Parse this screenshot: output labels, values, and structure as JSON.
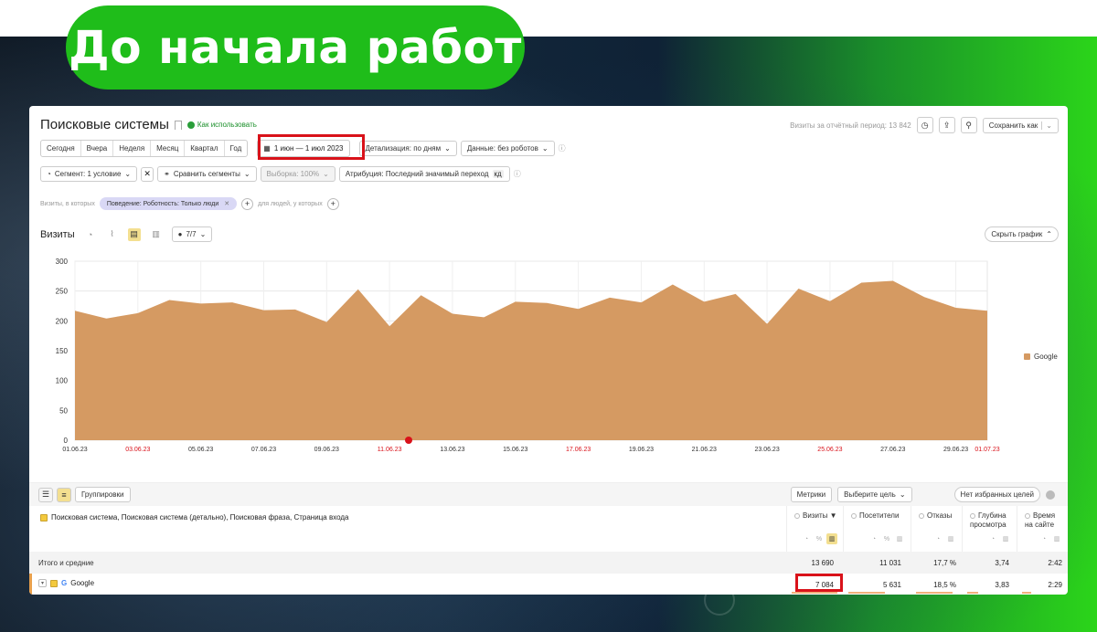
{
  "banner": {
    "title": "До начала работ"
  },
  "report": {
    "title": "Поисковые системы",
    "how_to_use": "Как использовать",
    "visits_summary": "Визиты за отчётный период: 13 842",
    "save_as": "Сохранить как"
  },
  "period_tabs": [
    "Сегодня",
    "Вчера",
    "Неделя",
    "Месяц",
    "Квартал",
    "Год"
  ],
  "date_range": "1 июн — 1 июл 2023",
  "detail": "Детализация: по дням",
  "data_filter": "Данные: без роботов",
  "segment": "Сегмент: 1 условие",
  "compare": "Сравнить сегменты",
  "sample": "Выборка: 100%",
  "attribution": "Атрибуция: Последний значимый переход",
  "attribution_badge": "кд",
  "filter": {
    "prefix": "Визиты, в которых",
    "chip": "Поведение: Роботность: Только люди",
    "suffix": "для людей, у которых"
  },
  "chart_header": {
    "label": "Визиты",
    "count": "7/7",
    "hide": "Скрыть график"
  },
  "chart_data": {
    "type": "area",
    "series": [
      {
        "name": "Google",
        "color": "#d59a62",
        "values": [
          217,
          204,
          213,
          235,
          229,
          231,
          218,
          219,
          198,
          253,
          191,
          243,
          212,
          206,
          232,
          230,
          220,
          239,
          231,
          261,
          232,
          245,
          195,
          254,
          233,
          264,
          267,
          240,
          222,
          217
        ]
      }
    ],
    "x": [
      "01.06.23",
      "02.06.23",
      "03.06.23",
      "04.06.23",
      "05.06.23",
      "06.06.23",
      "07.06.23",
      "08.06.23",
      "09.06.23",
      "10.06.23",
      "11.06.23",
      "12.06.23",
      "13.06.23",
      "14.06.23",
      "15.06.23",
      "16.06.23",
      "17.06.23",
      "18.06.23",
      "19.06.23",
      "20.06.23",
      "21.06.23",
      "22.06.23",
      "23.06.23",
      "24.06.23",
      "25.06.23",
      "26.06.23",
      "27.06.23",
      "28.06.23",
      "29.06.23",
      "01.07.23"
    ],
    "x_tick_labels": [
      {
        "label": "01.06.23",
        "red": false
      },
      {
        "label": "03.06.23",
        "red": true
      },
      {
        "label": "05.06.23",
        "red": false
      },
      {
        "label": "07.06.23",
        "red": false
      },
      {
        "label": "09.06.23",
        "red": false
      },
      {
        "label": "11.06.23",
        "red": true
      },
      {
        "label": "13.06.23",
        "red": false
      },
      {
        "label": "15.06.23",
        "red": false
      },
      {
        "label": "17.06.23",
        "red": true
      },
      {
        "label": "19.06.23",
        "red": false
      },
      {
        "label": "21.06.23",
        "red": false
      },
      {
        "label": "23.06.23",
        "red": false
      },
      {
        "label": "25.06.23",
        "red": true
      },
      {
        "label": "27.06.23",
        "red": false
      },
      {
        "label": "29.06.23",
        "red": false
      },
      {
        "label": "01.07.23",
        "red": true
      }
    ],
    "y_ticks": [
      0,
      50,
      100,
      150,
      200,
      250,
      300
    ],
    "ylim": [
      0,
      300
    ],
    "grid": true,
    "legend": "right"
  },
  "table": {
    "groupings": "Группировки",
    "metrics_btn": "Метрики",
    "goal_btn": "Выберите цель",
    "no_goals": "Нет избранных целей",
    "dimensions": "Поисковая система, Поисковая система (детально), Поисковая фраза, Страница входа",
    "columns": [
      "Визиты",
      "Посетители",
      "Отказы",
      "Глубина просмотра",
      "Время на сайте"
    ],
    "sort_marker": "▼",
    "totals_label": "Итого и средние",
    "totals": [
      "13 690",
      "11 031",
      "17,7 %",
      "3,74",
      "2:42"
    ],
    "rows": [
      {
        "label": "Google",
        "values": [
          "7 084",
          "5 631",
          "18,5 %",
          "3,83",
          "2:29"
        ]
      }
    ]
  }
}
